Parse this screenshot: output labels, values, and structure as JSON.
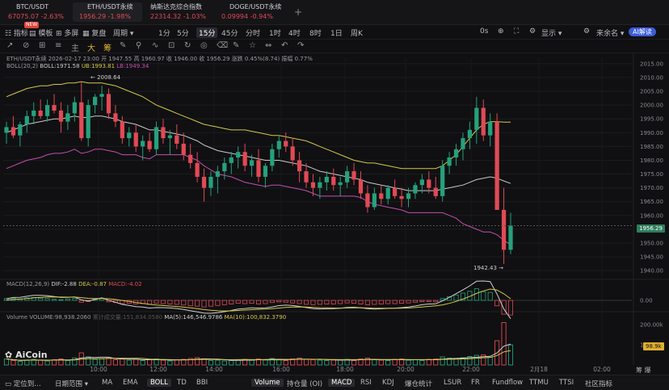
{
  "colors": {
    "up": "#26a17b",
    "down": "#e04a55",
    "boll_mid": "#c9c9c9",
    "boll_up": "#d4c84a",
    "boll_lo": "#c44fae",
    "price_tag": "#3d8c6d",
    "vol_tag": "#e0b030"
  },
  "tabs": [
    {
      "name": "BTC/USDT",
      "quote": "67075.07  -2.63%",
      "dot": "#f7931a",
      "active": false
    },
    {
      "name": "ETH/USDT永续",
      "quote": "1956.29  -1.98%",
      "dot": "#e8e8e8",
      "active": true
    },
    {
      "name": "纳斯达克综合指数",
      "quote": "22314.32  -1.03%",
      "dot": "",
      "active": false
    },
    {
      "name": "DOGE/USDT永续",
      "quote": "0.09994  -0.94%",
      "dot": "#c2a633",
      "active": false
    }
  ],
  "add_tab": "+",
  "toolbar": {
    "items": [
      {
        "label": "☷ 指标"
      },
      {
        "label": "▤ 模板"
      },
      {
        "label": "⊞ 多屏"
      },
      {
        "label": "▦ 复盘"
      },
      {
        "label": "周期 ▾"
      }
    ],
    "new_badge": "NEW",
    "timeframes": [
      "1分",
      "5分",
      "15分",
      "45分",
      "分时",
      "1时",
      "4时",
      "8时",
      "1日",
      "周K"
    ],
    "active_timeframe": "15分",
    "right": [
      "0s",
      "⊕",
      "⛶",
      "⚙",
      "显示 ▾",
      "⚙",
      "来余名 ▾"
    ],
    "ai": "AI解读"
  },
  "drawtools": [
    "↗",
    "⊘",
    "⊞",
    "≡",
    "主",
    "大",
    "筹",
    "✎",
    "⚲",
    "∿",
    "⊡",
    "↻",
    "◎",
    "⌫",
    "✎",
    "☆",
    "⇔",
    "↶",
    "↷"
  ],
  "chart": {
    "info_line": "ETH/USDT永续  2026-02-17 23:00  开 1947.55  高 1960.97  收 1946.00  收 1956.29  涨跌 0.45%(8.74)  振幅 0.77%",
    "boll_line": {
      "name": "BOLL(20,2)",
      "boll": "BOLL:1971.58",
      "ub": "UB:1993.81",
      "lb": "LB:1949.34"
    },
    "macd_line": {
      "name": "MACD(12,26,9)",
      "dif": "DIF:-2.88",
      "dea": "DEA:-0.87",
      "macd": "MACD:-4.02"
    },
    "vol_line": {
      "name": "Volume  VOLUME:98,938.2060",
      "extra": "累计成交量:151,834.0580",
      "ma5": "MA(5):146,546.9786",
      "ma10": "MA(10):100,832.3790"
    },
    "high_marker": "← 2008.64",
    "low_marker": "1942.43 →",
    "current_price": "1956.29",
    "vol_current": "98.9k",
    "price_labels": [
      "2015.00",
      "2010.00",
      "2005.00",
      "2000.00",
      "1995.00",
      "1990.00",
      "1985.00",
      "1980.00",
      "1975.00",
      "1970.00",
      "1965.00",
      "1960.00",
      "1955.00",
      "1950.00",
      "1945.00",
      "1940.00"
    ],
    "macd_labels": [
      "0.00"
    ],
    "vol_labels": [
      "200.00k",
      "100.00k"
    ],
    "time_labels": [
      "10:00",
      "12:00",
      "14:00",
      "16:00",
      "18:00",
      "20:00",
      "22:00",
      "2月18",
      "02:00"
    ],
    "watermark": "AiCoin",
    "right_tools": [
      "筹",
      "爆"
    ]
  },
  "bottom": {
    "left": [
      "▭ 定位到…",
      "日期范围 ▾"
    ],
    "indicators": [
      "MA",
      "EMA",
      "BOLL",
      "TD",
      "BBI"
    ],
    "active_indicator": "BOLL",
    "sub": [
      "Volume",
      "持仓量 (OI)",
      "MACD",
      "RSI",
      "KDJ",
      "爆仓统计",
      "LSUR",
      "FR",
      "Fundflow",
      "TTMU",
      "TTSI",
      "社区指标"
    ],
    "active_sub": [
      "Volume",
      "MACD"
    ]
  },
  "chart_data": {
    "type": "candlestick",
    "title": "ETH/USDT永续",
    "interval": "15m",
    "ylim": [
      1938,
      2017
    ],
    "candles": [
      [
        1990,
        1994,
        1986,
        1992
      ],
      [
        1992,
        1996,
        1988,
        1989
      ],
      [
        1989,
        1994,
        1985,
        1993
      ],
      [
        1993,
        1998,
        1990,
        1996
      ],
      [
        1996,
        2001,
        1993,
        1998
      ],
      [
        1998,
        2002,
        1995,
        1996
      ],
      [
        1996,
        2002,
        1994,
        2000
      ],
      [
        2000,
        2004,
        1997,
        1998
      ],
      [
        1998,
        2001,
        1990,
        1994
      ],
      [
        1994,
        2000,
        1991,
        1997
      ],
      [
        1997,
        2003,
        1994,
        2001
      ],
      [
        2001,
        2008.64,
        1987,
        1988
      ],
      [
        1988,
        2002,
        1985,
        2000
      ],
      [
        2000,
        2004,
        1997,
        2003
      ],
      [
        2003,
        2007,
        1998,
        2004
      ],
      [
        2004,
        2006,
        1995,
        1997
      ],
      [
        1997,
        2000,
        1992,
        1994
      ],
      [
        1994,
        1996,
        1986,
        1988
      ],
      [
        1988,
        1992,
        1985,
        1990
      ],
      [
        1990,
        1993,
        1983,
        1985
      ],
      [
        1985,
        1989,
        1980,
        1987
      ],
      [
        1987,
        1990,
        1983,
        1984
      ],
      [
        1984,
        1994,
        1982,
        1992
      ],
      [
        1992,
        1995,
        1986,
        1988
      ],
      [
        1988,
        1991,
        1982,
        1989
      ],
      [
        1989,
        1993,
        1984,
        1986
      ],
      [
        1986,
        1990,
        1980,
        1982
      ],
      [
        1982,
        1986,
        1977,
        1979
      ],
      [
        1979,
        1983,
        1972,
        1974
      ],
      [
        1974,
        1977,
        1965,
        1970
      ],
      [
        1970,
        1976,
        1967,
        1974
      ],
      [
        1974,
        1978,
        1968,
        1976
      ],
      [
        1976,
        1981,
        1973,
        1979
      ],
      [
        1979,
        1983,
        1975,
        1981
      ],
      [
        1981,
        1985,
        1977,
        1983
      ],
      [
        1983,
        1986,
        1976,
        1978
      ],
      [
        1978,
        1982,
        1974,
        1980
      ],
      [
        1980,
        1984,
        1972,
        1974
      ],
      [
        1974,
        1979,
        1970,
        1978
      ],
      [
        1978,
        1986,
        1976,
        1984
      ],
      [
        1984,
        1989,
        1981,
        1987
      ],
      [
        1987,
        1990,
        1983,
        1985
      ],
      [
        1985,
        1988,
        1978,
        1980
      ],
      [
        1980,
        1983,
        1972,
        1976
      ],
      [
        1976,
        1979,
        1970,
        1972
      ],
      [
        1972,
        1975,
        1967,
        1970
      ],
      [
        1970,
        1974,
        1966,
        1972
      ],
      [
        1972,
        1976,
        1969,
        1974
      ],
      [
        1974,
        1977,
        1969,
        1971
      ],
      [
        1971,
        1974,
        1967,
        1972
      ],
      [
        1972,
        1978,
        1970,
        1976
      ],
      [
        1976,
        1979,
        1971,
        1973
      ],
      [
        1973,
        1976,
        1966,
        1968
      ],
      [
        1968,
        1971,
        1961,
        1963
      ],
      [
        1963,
        1970,
        1962,
        1968
      ],
      [
        1968,
        1971,
        1964,
        1966
      ],
      [
        1966,
        1971,
        1964,
        1970
      ],
      [
        1970,
        1973,
        1966,
        1967
      ],
      [
        1967,
        1970,
        1963,
        1966
      ],
      [
        1966,
        1970,
        1963,
        1968
      ],
      [
        1968,
        1972,
        1966,
        1971
      ],
      [
        1971,
        1975,
        1968,
        1973
      ],
      [
        1973,
        1976,
        1968,
        1970
      ],
      [
        1970,
        1974,
        1966,
        1967
      ],
      [
        1967,
        1980,
        1965,
        1978
      ],
      [
        1978,
        1983,
        1975,
        1981
      ],
      [
        1981,
        1986,
        1978,
        1984
      ],
      [
        1984,
        1990,
        1980,
        1988
      ],
      [
        1988,
        1994,
        1984,
        1991
      ],
      [
        1991,
        2003,
        1986,
        1999
      ],
      [
        1999,
        2002,
        1987,
        1989
      ],
      [
        1989,
        1997,
        1985,
        1994
      ],
      [
        1994,
        1997,
        1978,
        1962
      ],
      [
        1962,
        1970,
        1942.43,
        1947.55
      ],
      [
        1947.55,
        1960.97,
        1946,
        1956.29
      ]
    ],
    "volume_k": [
      30,
      22,
      18,
      25,
      28,
      24,
      20,
      26,
      30,
      22,
      35,
      60,
      40,
      28,
      30,
      34,
      26,
      30,
      24,
      28,
      22,
      26,
      30,
      24,
      20,
      26,
      28,
      32,
      36,
      30,
      22,
      24,
      20,
      22,
      26,
      28,
      24,
      30,
      26,
      32,
      28,
      22,
      30,
      34,
      28,
      26,
      24,
      22,
      26,
      24,
      28,
      22,
      30,
      34,
      26,
      24,
      22,
      28,
      30,
      24,
      26,
      22,
      28,
      30,
      40,
      34,
      30,
      36,
      42,
      48,
      50,
      38,
      120,
      210,
      99
    ],
    "boll_mid": [
      1990,
      1991,
      1992,
      1993,
      1993.5,
      1994,
      1994.5,
      1995,
      1995,
      1995.5,
      1996,
      1995.5,
      1995.5,
      1996,
      1996,
      1995.5,
      1995,
      1994,
      1993.5,
      1993,
      1992,
      1991,
      1991,
      1990.5,
      1990,
      1989.5,
      1989,
      1988,
      1987,
      1985.5,
      1984.5,
      1983.5,
      1983,
      1982.5,
      1982,
      1981.5,
      1981,
      1980.5,
      1980,
      1980,
      1980,
      1979.5,
      1979,
      1978.5,
      1978,
      1977,
      1976,
      1975.5,
      1975,
      1974.5,
      1974,
      1973.5,
      1973,
      1972,
      1971.5,
      1971,
      1970.5,
      1970,
      1969.5,
      1969,
      1969,
      1969,
      1969,
      1969,
      1969.5,
      1970,
      1970.5,
      1971,
      1972,
      1973,
      1973.5,
      1974,
      1973.5,
      1972.5,
      1971.58
    ],
    "boll_up": [
      2003,
      2004,
      2005,
      2006,
      2006.5,
      2007,
      2007,
      2007.5,
      2007.5,
      2008,
      2008,
      2008.5,
      2008,
      2008,
      2008,
      2007.5,
      2007,
      2006,
      2005,
      2004,
      2003,
      2001.5,
      2000,
      1999,
      1998,
      1997,
      1996,
      1995,
      1994,
      1993,
      1992.5,
      1992,
      1991.5,
      1991,
      1991,
      1991,
      1990.5,
      1990,
      1989.5,
      1989,
      1989,
      1988.5,
      1988,
      1987.5,
      1987,
      1986,
      1985,
      1984,
      1983,
      1982,
      1981,
      1980,
      1979.5,
      1979,
      1979,
      1978.5,
      1978,
      1977.5,
      1977,
      1977,
      1977,
      1977,
      1977,
      1977,
      1978,
      1980,
      1982,
      1985,
      1988,
      1991,
      1993,
      1994,
      1994,
      1993.81,
      1993.81
    ],
    "boll_lo": [
      1977,
      1978,
      1979,
      1980,
      1980.5,
      1981,
      1982,
      1982.5,
      1982.5,
      1983,
      1984,
      1982.5,
      1983,
      1984,
      1984,
      1983.5,
      1983,
      1982,
      1982,
      1982,
      1981,
      1980.5,
      1982,
      1982,
      1982,
      1982,
      1982,
      1981,
      1980,
      1978,
      1976.5,
      1975,
      1974.5,
      1974,
      1973,
      1972,
      1971.5,
      1971,
      1970.5,
      1971,
      1971,
      1970.5,
      1970,
      1969.5,
      1969,
      1968,
      1967,
      1967,
      1967,
      1967,
      1967,
      1967,
      1966.5,
      1965,
      1964,
      1963.5,
      1963,
      1962.5,
      1962,
      1961,
      1961,
      1961,
      1961,
      1961,
      1961,
      1960,
      1959,
      1957,
      1956,
      1955,
      1954,
      1954,
      1953,
      1951,
      1949.34
    ],
    "macd_hist": [
      0.5,
      0.6,
      0.4,
      0.7,
      0.8,
      0.6,
      0.5,
      0.3,
      0.2,
      0.4,
      0.5,
      -0.5,
      -0.3,
      0.4,
      0.6,
      -0.4,
      -0.6,
      -0.9,
      -0.8,
      -1.0,
      -0.9,
      -1.1,
      -0.8,
      -0.9,
      -1.0,
      -1.1,
      -1.3,
      -1.5,
      -1.6,
      -1.8,
      -1.6,
      -1.4,
      -1.2,
      -1.0,
      -0.8,
      -0.9,
      -0.8,
      -1.0,
      -0.9,
      -0.6,
      -0.4,
      -0.5,
      -0.7,
      -0.9,
      -1.1,
      -1.2,
      -1.1,
      -1.0,
      -1.0,
      -0.9,
      -0.7,
      -0.8,
      -1.0,
      -1.2,
      -1.1,
      -1.0,
      -0.9,
      -0.9,
      -0.8,
      -0.7,
      -0.5,
      -0.3,
      -0.3,
      -0.4,
      0.5,
      1.0,
      1.5,
      2.0,
      2.5,
      3.2,
      2.4,
      2.2,
      -1.5,
      -3.8,
      -4.02
    ]
  }
}
